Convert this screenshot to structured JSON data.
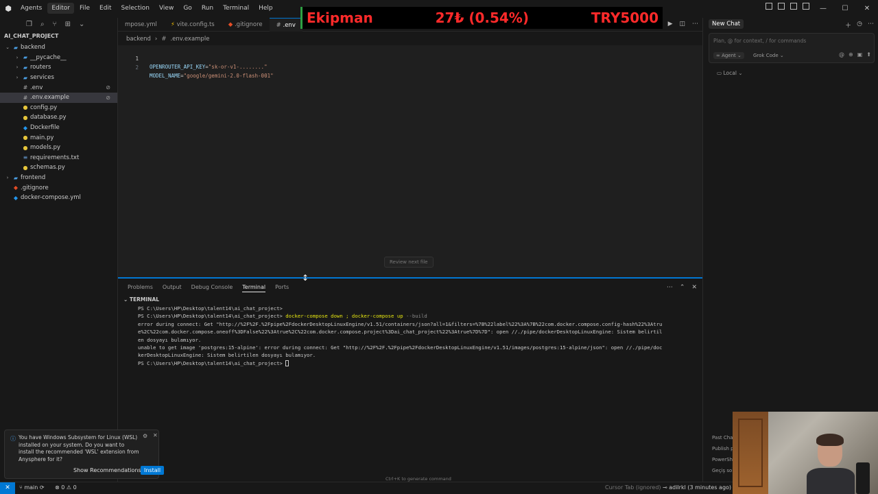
{
  "titlebar": {
    "menus": [
      "Agents",
      "Editor",
      "File",
      "Edit",
      "Selection",
      "View",
      "Go",
      "Run",
      "Terminal",
      "Help"
    ],
    "active_menu_index": 1
  },
  "ticker": {
    "name": "Ekipman",
    "change": "27₺ (0.54%)",
    "price": "TRY5000"
  },
  "explorer": {
    "root": "AI_CHAT_PROJECT",
    "items": [
      {
        "label": "backend",
        "kind": "folder-open",
        "depth": 0
      },
      {
        "label": "__pycache__",
        "kind": "folder",
        "depth": 1
      },
      {
        "label": "routers",
        "kind": "folder",
        "depth": 1
      },
      {
        "label": "services",
        "kind": "folder",
        "depth": 1
      },
      {
        "label": ".env",
        "kind": "env",
        "depth": 1,
        "badge": "⊘"
      },
      {
        "label": ".env.example",
        "kind": "env",
        "depth": 1,
        "badge": "⊘",
        "selected": true
      },
      {
        "label": "config.py",
        "kind": "py",
        "depth": 1
      },
      {
        "label": "database.py",
        "kind": "py",
        "depth": 1
      },
      {
        "label": "Dockerfile",
        "kind": "docker",
        "depth": 1
      },
      {
        "label": "main.py",
        "kind": "py",
        "depth": 1
      },
      {
        "label": "models.py",
        "kind": "py",
        "depth": 1
      },
      {
        "label": "requirements.txt",
        "kind": "txt",
        "depth": 1
      },
      {
        "label": "schemas.py",
        "kind": "py",
        "depth": 1
      },
      {
        "label": "frontend",
        "kind": "folder",
        "depth": 0
      },
      {
        "label": ".gitignore",
        "kind": "git",
        "depth": 0
      },
      {
        "label": "docker-compose.yml",
        "kind": "docker",
        "depth": 0
      }
    ]
  },
  "notification": {
    "message": "You have Windows Subsystem for Linux (WSL) installed on your system. Do you want to install the recommended 'WSL' extension from Anysphere for it?",
    "secondary_button": "Show Recommendations",
    "primary_button": "Install"
  },
  "editor": {
    "tabs": [
      {
        "label": "mpose.yml",
        "active": false
      },
      {
        "label": "vite.config.ts",
        "active": false
      },
      {
        "label": ".gitignore",
        "active": false
      },
      {
        "label": ".env",
        "active": true
      }
    ],
    "breadcrumb": [
      "backend",
      ".env.example"
    ],
    "lines": [
      {
        "num": "1",
        "key": "OPENROUTER_API_KEY",
        "value": "\"sk-or-v1-........\""
      },
      {
        "num": "2",
        "key": "MODEL_NAME",
        "value": "\"google/gemini-2.0-flash-001\""
      }
    ],
    "review_label": "Review next file"
  },
  "panel": {
    "tabs": [
      "Problems",
      "Output",
      "Debug Console",
      "Terminal",
      "Ports"
    ],
    "active_tab_index": 3,
    "terminal_header": "TERMINAL",
    "prompt": "PS C:\\Users\\HP\\Desktop\\talent14\\ai_chat_project>",
    "command": "docker-compose down ; docker-compose up",
    "command_flag": "--build",
    "output": [
      "error during connect: Get \"http://%2F%2F.%2Fpipe%2FdockerDesktopLinuxEngine/v1.51/containers/json?all=1&filters=%7B%22label%22%3A%7B%22com.docker.compose.config-hash%22%3Atru",
      "e%2C%22com.docker.compose.oneoff%3DFalse%22%3Atrue%2C%22com.docker.compose.project%3Dai_chat_project%22%3Atrue%7D%7D\": open //./pipe/dockerDesktopLinuxEngine: Sistem belirtil",
      "en dosyayı bulamıyor.",
      "unable to get image 'postgres:15-alpine': error during connect: Get \"http://%2F%2F.%2Fpipe%2FdockerDesktopLinuxEngine/v1.51/images/postgres:15-alpine/json\": open //./pipe/doc",
      "kerDesktopLinuxEngine: Sistem belirtilen dosyayı bulamıyor."
    ],
    "hint": "Ctrl+K to generate command"
  },
  "chat": {
    "tab": "New Chat",
    "placeholder": "Plan, @ for context, / for commands",
    "agent_label": "Agent",
    "model_label": "Grok Code",
    "local_label": "Local",
    "past_items": [
      "Past Cha",
      "Publish p",
      "PowerSh",
      "Geçiş sor"
    ]
  },
  "statusbar": {
    "branch": "main",
    "errors": "⊗ 0 ⚠ 0",
    "cursor_tab": "Cursor Tab (ignored)",
    "blame": "adilrkl (3 minutes ago)"
  }
}
